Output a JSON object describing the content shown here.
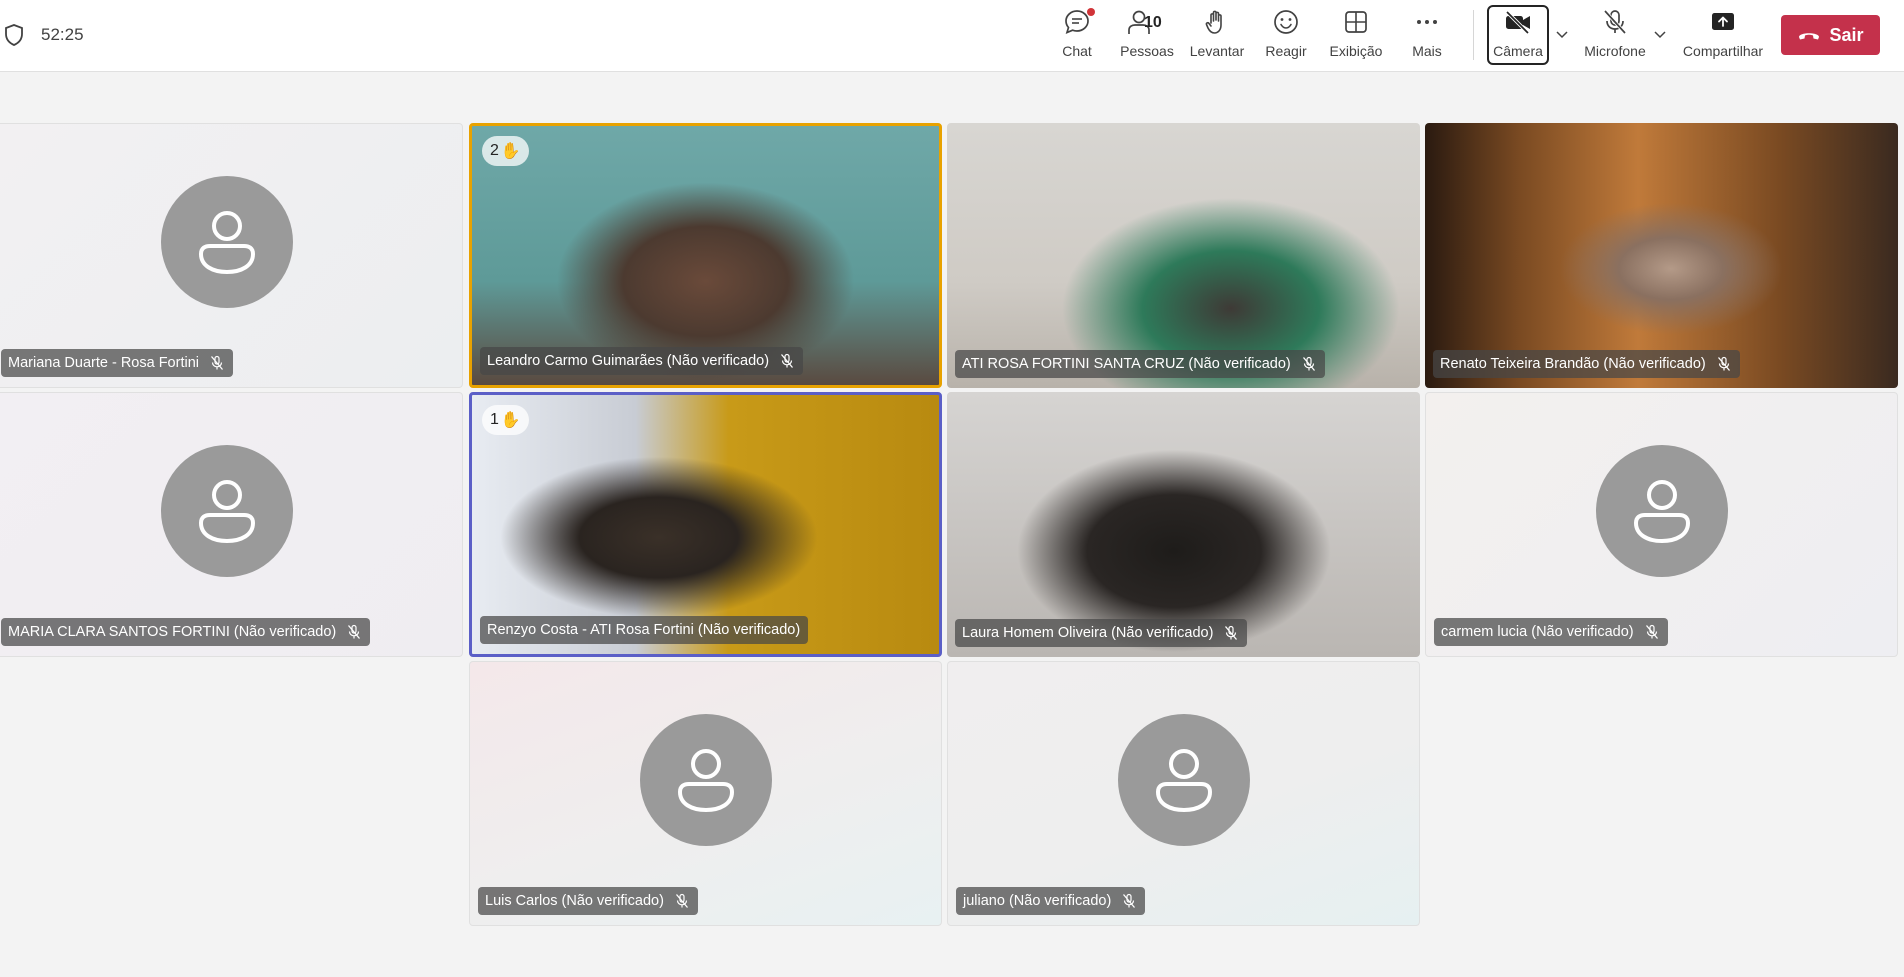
{
  "meeting": {
    "elapsed_time": "52:25"
  },
  "toolbar": {
    "chat_label": "Chat",
    "people_label": "Pessoas",
    "people_count": "10",
    "raise_label": "Levantar",
    "react_label": "Reagir",
    "view_label": "Exibição",
    "more_label": "Mais",
    "camera_label": "Câmera",
    "mic_label": "Microfone",
    "share_label": "Compartilhar",
    "leave_label": "Sair",
    "leave_color": "#c4314b"
  },
  "participants": [
    {
      "name": "Mariana Duarte - Rosa Fortini",
      "video": false,
      "muted": true
    },
    {
      "name": "Leandro Carmo Guimarães (Não verificado)",
      "video": true,
      "muted": true,
      "hand_raised_order": "2",
      "highlight": "#e8a200"
    },
    {
      "name": "ATI ROSA FORTINI SANTA CRUZ (Não verificado)",
      "video": true,
      "muted": true
    },
    {
      "name": "Renato Teixeira Brandão (Não verificado)",
      "video": true,
      "muted": true
    },
    {
      "name": "MARIA CLARA SANTOS FORTINI (Não verificado)",
      "video": false,
      "muted": true
    },
    {
      "name": "Renzyo Costa - ATI Rosa Fortini (Não verificado)",
      "video": true,
      "muted": true,
      "hand_raised_order": "1",
      "highlight": "#5b5fc7"
    },
    {
      "name": "Laura Homem Oliveira (Não verificado)",
      "video": true,
      "muted": true
    },
    {
      "name": "carmem lucia (Não verificado)",
      "video": false,
      "muted": true
    },
    {
      "name": "Luis Carlos (Não verificado)",
      "video": false,
      "muted": true
    },
    {
      "name": "juliano (Não verificado)",
      "video": false,
      "muted": true
    }
  ]
}
